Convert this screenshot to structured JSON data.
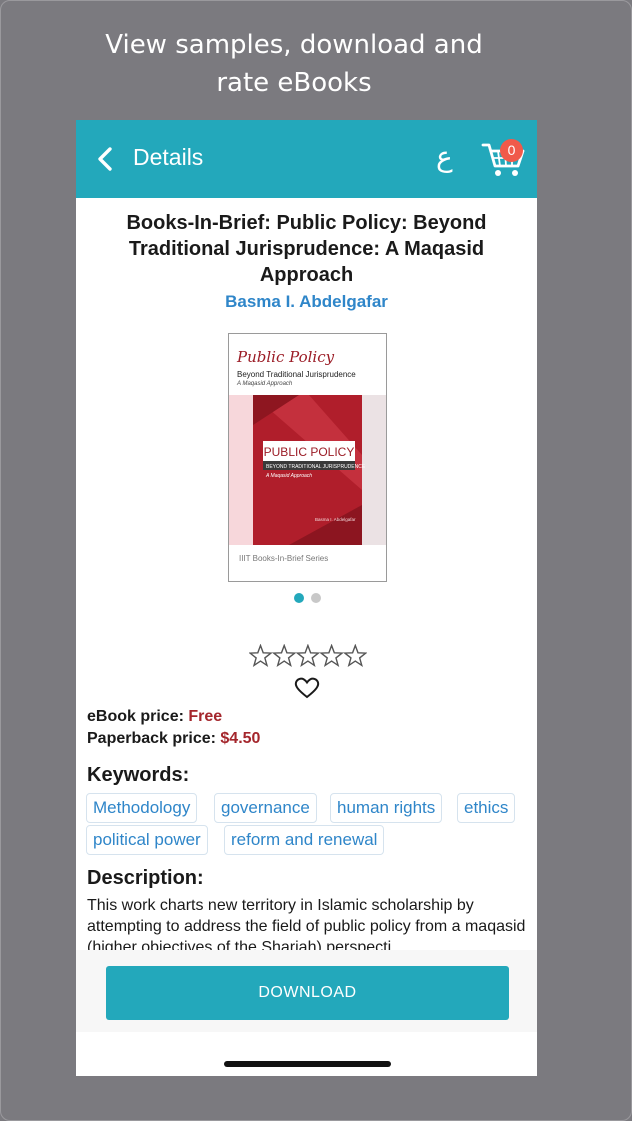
{
  "promo": {
    "line1": "View samples, download and",
    "line2": "rate eBooks"
  },
  "appbar": {
    "title": "Details",
    "lang_label": "ع",
    "cart_count": "0",
    "color": "#23a8bb"
  },
  "book": {
    "title": "Books-In-Brief: Public Policy: Beyond Traditional Jurisprudence: A Maqasid Approach",
    "author": "Basma I. Abdelgafar",
    "cover": {
      "title": "Public Policy",
      "subtitle": "Beyond Traditional Jurisprudence",
      "tagline": "A Maqasid Approach",
      "band_title": "PUBLIC POLICY",
      "band_sub": "BEYOND TRADITIONAL JURISPRUDENCE",
      "band_sub2": "A Maqasid Approach",
      "band_author": "Basma I. Abdelgafar",
      "series": "IIIT Books-In-Brief Series"
    },
    "carousel": {
      "pages": 2,
      "active": 1
    },
    "rating": {
      "value": 0,
      "max": 5
    }
  },
  "prices": {
    "ebook_label": "eBook price:",
    "ebook_value": "Free",
    "paperback_label": "Paperback price:",
    "paperback_value": "$4.50"
  },
  "keywords": {
    "heading": "Keywords:",
    "items": [
      "Methodology",
      "governance",
      "human rights",
      "ethics",
      "political power",
      "reform and renewal"
    ]
  },
  "description": {
    "heading": "Description:",
    "text": "This work charts new territory in Islamic scholarship by attempting to address the field of public policy from a maqasid (higher objectives of the Shariah) perspecti"
  },
  "actions": {
    "download_label": "DOWNLOAD"
  }
}
